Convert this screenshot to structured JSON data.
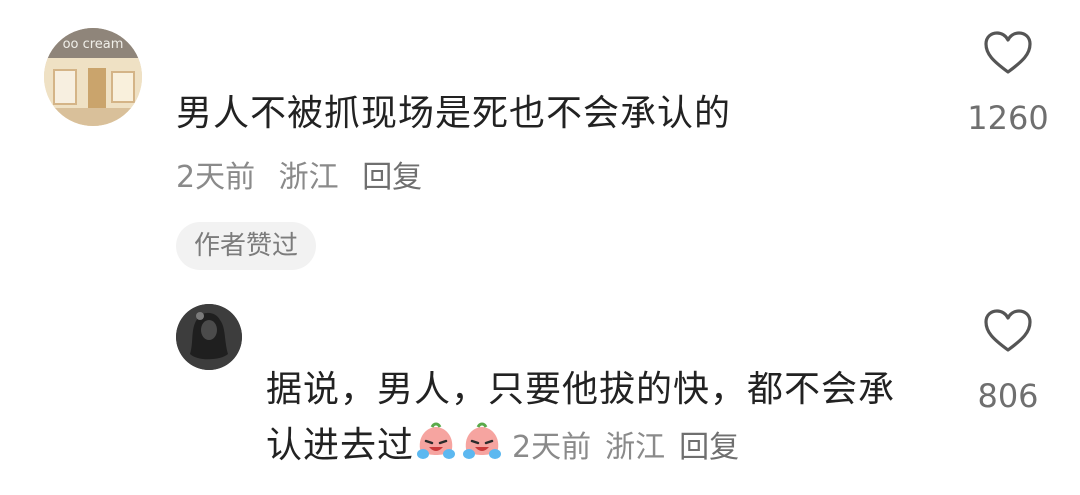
{
  "comments": [
    {
      "text": "男人不被抓现场是死也不会承认的",
      "time": "2天前",
      "location": "浙江",
      "reply": "回复",
      "likes": "1260",
      "badge": "作者赞过",
      "avatar_text": "oo cream"
    },
    {
      "text_line1": "据说，男人，只要他拔的快，都不会承",
      "text_line2": "认进去过",
      "emojis": [
        "crying-laugh-emoji",
        "crying-laugh-emoji"
      ],
      "time": "2天前",
      "location": "浙江",
      "reply": "回复",
      "likes": "806"
    }
  ],
  "colors": {
    "text": "#222222",
    "meta": "#8a8a8a",
    "badge_bg": "#f2f2f2",
    "heart_stroke": "#555555"
  }
}
